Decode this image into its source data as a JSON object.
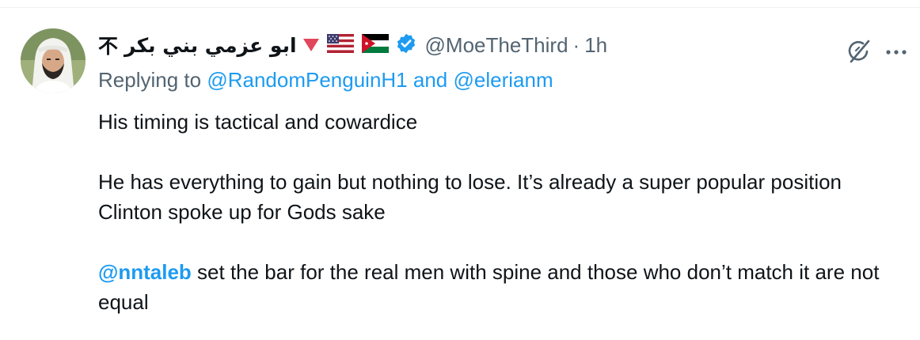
{
  "tweet": {
    "display_name": "ابو عزمي بني بكر",
    "name_symbol": "不",
    "handle": "@MoeTheThird",
    "separator": "·",
    "timestamp": "1h",
    "flags": [
      "us-flag",
      "jordan-flag"
    ],
    "verified": true,
    "colors": {
      "link": "#1d9bf0",
      "muted": "#536471",
      "text": "#0f1419",
      "triangle": "#e0475b"
    },
    "reply": {
      "prefix": "Replying to",
      "user1": "@RandomPenguinH1",
      "connector": "and",
      "user2": "@elerianm"
    },
    "body": {
      "para1": "His timing is tactical and cowardice",
      "para2": "He has everything to gain but nothing to lose. It’s already a super popular position Clinton spoke up for Gods sake",
      "mention": "@nntaleb",
      "para3_rest": " set the bar for the real men with spine and those who don’t match it are not equal"
    }
  },
  "icons": [
    "grok-icon",
    "more-icon",
    "verified-badge-icon",
    "down-triangle-icon"
  ]
}
